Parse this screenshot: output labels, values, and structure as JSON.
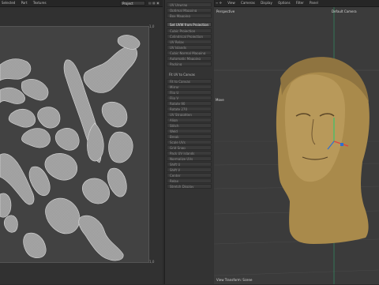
{
  "left_menu": [
    "Selected",
    "Part",
    "Textures"
  ],
  "left_dropdown": "Project",
  "right_menu": [
    "View",
    "Cameras",
    "Display",
    "Options",
    "Filter",
    "Panel"
  ],
  "viewport": {
    "view_name": "Perspective",
    "camera_name": "Default Camera",
    "move_label": "Move",
    "footer": "View Transform: Scene"
  },
  "uv_corner_top": "1,0",
  "uv_corner_bottom": "1,0",
  "commands": [
    {
      "label": "UV Unwrap",
      "active": false
    },
    {
      "label": "Optimal Mapping",
      "active": false
    },
    {
      "label": "Box Mapping",
      "active": false
    },
    {
      "label": "Set UVW from Projection",
      "active": true
    },
    {
      "label": "Cubic Projection",
      "active": false
    },
    {
      "label": "Cylindrical Projection",
      "active": false
    },
    {
      "label": "UV Relax",
      "active": false
    },
    {
      "label": "UV Islands",
      "active": false
    },
    {
      "label": "Cubic Normal Mapping",
      "active": false
    },
    {
      "label": "Automatic Mapping",
      "active": false
    },
    {
      "label": "Packing",
      "active": false
    }
  ],
  "section_label": "Fit UV to Canvas",
  "commands2": [
    "Fit to Canvas",
    "Mirror",
    "Flip U",
    "Flip V",
    "Rotate 90",
    "Rotate 270",
    "UV Straighten",
    "Align",
    "Stitch",
    "Weld",
    "Break",
    "Scale UVs",
    "Grid Snap",
    "Pack UV Islands",
    "Normalize UVs",
    "Shift U",
    "Shift V",
    "Center",
    "Relax",
    "Stretch Display"
  ],
  "colors": {
    "bust": "#b08f4f",
    "uv_fill": "#aaaaaa",
    "accent": "#2f6fd0"
  }
}
